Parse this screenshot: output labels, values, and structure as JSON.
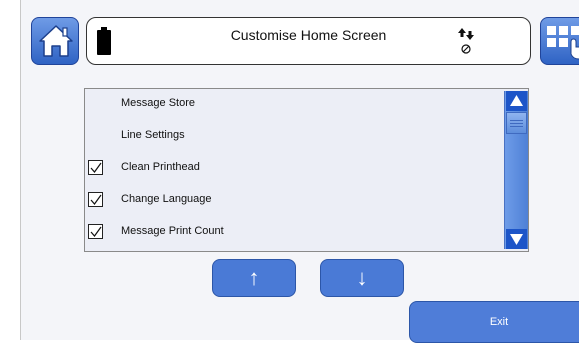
{
  "header": {
    "title": "Customise Home Screen",
    "battery_icon": "battery-icon",
    "status_icon": "connection-status-icon"
  },
  "toolbar": {
    "home_icon": "home-icon",
    "grid_icon": "grid-touch-icon"
  },
  "list": {
    "items": [
      {
        "label": "Message Store",
        "checked": false
      },
      {
        "label": "Line Settings",
        "checked": false
      },
      {
        "label": "Clean Printhead",
        "checked": true
      },
      {
        "label": "Change Language",
        "checked": true
      },
      {
        "label": "Message Print Count",
        "checked": true
      }
    ]
  },
  "controls": {
    "up_label": "↑",
    "down_label": "↓",
    "exit_label": "Exit"
  },
  "colors": {
    "accent": "#4a7ad6",
    "scrollbar": "#5b8ee0",
    "panel": "#eceef6"
  }
}
